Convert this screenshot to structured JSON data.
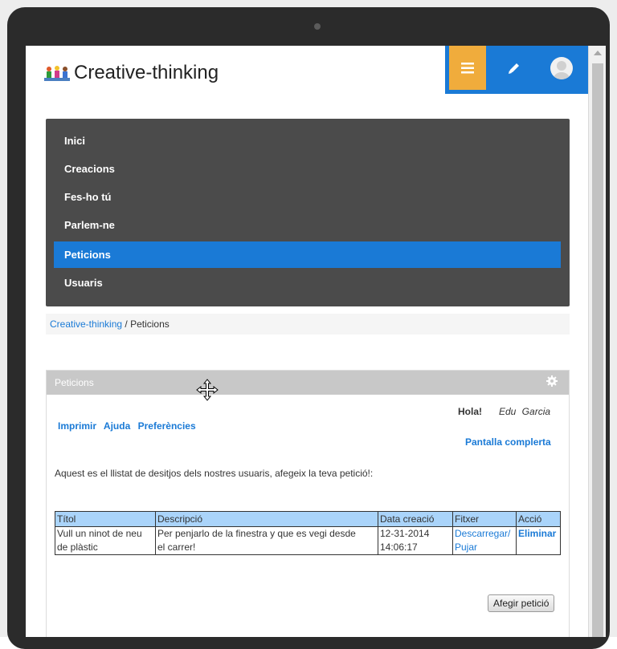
{
  "site": {
    "title": "Creative-thinking"
  },
  "topbar": {
    "menu_icon": "hamburger-icon",
    "edit_icon": "pencil-icon",
    "avatar_icon": "user-avatar-icon",
    "accent": "#1a7ad6",
    "menu_color": "#f0ac3c"
  },
  "nav": {
    "items": [
      {
        "label": "Inici"
      },
      {
        "label": "Creacions"
      },
      {
        "label": "Fes-ho tú"
      },
      {
        "label": "Parlem-ne"
      },
      {
        "label": "Peticions",
        "active": true
      },
      {
        "label": "Usuaris"
      }
    ]
  },
  "breadcrumb": {
    "home": "Creative-thinking",
    "separator": "/",
    "current": "Peticions"
  },
  "panel": {
    "title": "Peticions",
    "greeting": "Hola!",
    "user": "Edu Garcia",
    "toolbar": [
      "Imprimir",
      "Ajuda",
      "Preferències"
    ],
    "fullscreen": "Pantalla complerta",
    "intro": "Aquest es el llistat de desitjos dels nostres usuaris, afegeix la teva petició!:",
    "table": {
      "headers": [
        "Títol",
        "Descripció",
        "Data creació",
        "Fitxer",
        "Acció"
      ],
      "rows": [
        {
          "title_line1": "Vull un ninot de neu",
          "title_line2": "de plàstic",
          "desc_line1": "Per penjarlo de la finestra y que es vegi desde",
          "desc_line2": "el carrer!",
          "date_line1": "12-31-2014",
          "date_line2": "14:06:17",
          "file_download": "Descarregar/",
          "file_upload": "Pujar",
          "action": "Eliminar"
        }
      ]
    },
    "add_button": "Afegir petició"
  }
}
